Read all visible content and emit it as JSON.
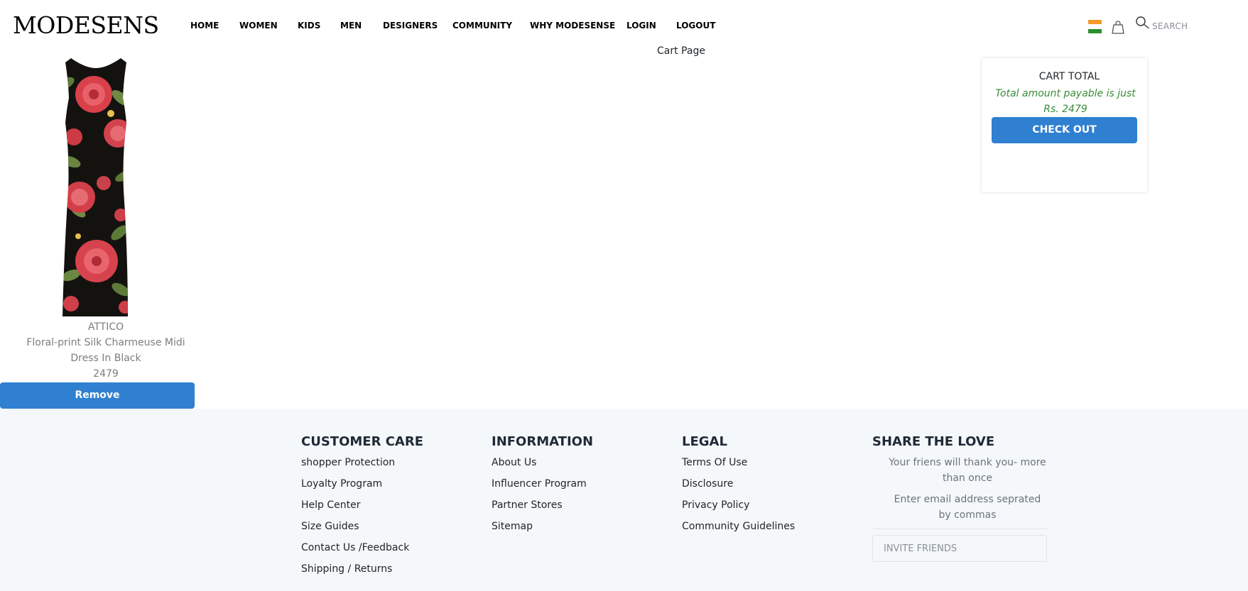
{
  "header": {
    "logo": "MODESENS",
    "nav": [
      "HOME",
      "WOMEN",
      "KIDS",
      "MEN",
      "DESIGNERS",
      "COMMUNITY",
      "WHY MODESENSE",
      "LOGIN",
      "LOGOUT"
    ],
    "subtitle": "Cart Page",
    "search_label": "SEARCH"
  },
  "product": {
    "brand": "ATTICO",
    "name_line1": "Floral-print Silk Charmeuse Midi",
    "name_line2": "Dress In Black",
    "price": "2479",
    "remove_label": "Remove"
  },
  "cart": {
    "title": "CART TOTAL",
    "note": "Total amount payable is just Rs. 2479",
    "checkout_label": "CHECK OUT"
  },
  "footer": {
    "customer_care": {
      "title": "CUSTOMER CARE",
      "links": [
        "shopper Protection",
        "Loyalty Program",
        "Help Center",
        "Size Guides",
        "Contact Us /Feedback",
        "Shipping / Returns"
      ]
    },
    "information": {
      "title": "INFORMATION",
      "links": [
        "About Us",
        "Influencer Program",
        "Partner Stores",
        "Sitemap"
      ]
    },
    "legal": {
      "title": "LEGAL",
      "links": [
        "Terms Of Use",
        "Disclosure",
        "Privacy Policy",
        "Community Guidelines"
      ]
    },
    "share": {
      "title": "SHARE THE LOVE",
      "text1": "Your friens will thank you- more than once",
      "text2": "Enter email address seprated by commas",
      "invite_placeholder": "INVITE FRIENDS"
    }
  },
  "colors": {
    "primary": "#2f80d1",
    "success_text": "#3a8a3a",
    "footer_bg": "#f5f8fa"
  },
  "icons": {
    "flag": "india-flag-icon",
    "bag": "shopping-bag-icon",
    "search": "search-icon"
  }
}
